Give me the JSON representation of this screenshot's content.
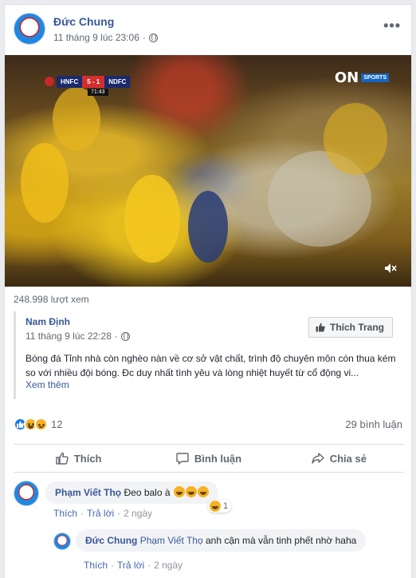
{
  "post": {
    "author": "Đức Chung",
    "timestamp": "11 tháng 9 lúc 23:06",
    "privacy_icon": "globe-icon",
    "more_label": "•••"
  },
  "video": {
    "scoreboard": {
      "home": "HNFC",
      "score": "5 - 1",
      "away": "NDFC",
      "clock": "71:43"
    },
    "broadcaster": {
      "logo": "ON",
      "tag": "SPORTS"
    },
    "view_count": "248.998 lượt xem"
  },
  "shared_post": {
    "page_name": "Nam Định",
    "timestamp": "11 tháng 9 lúc 22:28",
    "like_page_label": "Thích Trang",
    "text": "Bóng đá Tỉnh nhà còn nghèo nàn về cơ sở vật chất, trình độ chuyên môn còn thua kém so với nhiều đội bóng. Đc duy nhất tình yêu và lòng nhiệt huyết từ cổ động vi...",
    "see_more": "Xem thêm"
  },
  "stats": {
    "reaction_icons": [
      "like-icon",
      "haha-icon",
      "sad-icon"
    ],
    "reaction_count": "12",
    "comment_count": "29 bình luận"
  },
  "actions": {
    "like": "Thích",
    "comment": "Bình luận",
    "share": "Chia sẻ"
  },
  "comments": [
    {
      "author": "Phạm Viết Thọ",
      "text": "Đeo balo à",
      "emoji_count": 3,
      "reaction_count": "1",
      "like_label": "Thích",
      "reply_label": "Trả lời",
      "time": "2 ngày",
      "reply": {
        "author": "Đức Chung",
        "mention": "Phạm Viết Thọ",
        "text": "anh cận mà vẫn tinh phết nhờ haha",
        "like_label": "Thích",
        "reply_label": "Trả lời",
        "time": "2 ngày"
      }
    }
  ],
  "colors": {
    "link_blue": "#365899",
    "like_blue": "#1877f2",
    "haha_yellow": "#f7b125",
    "muted": "#606770"
  }
}
